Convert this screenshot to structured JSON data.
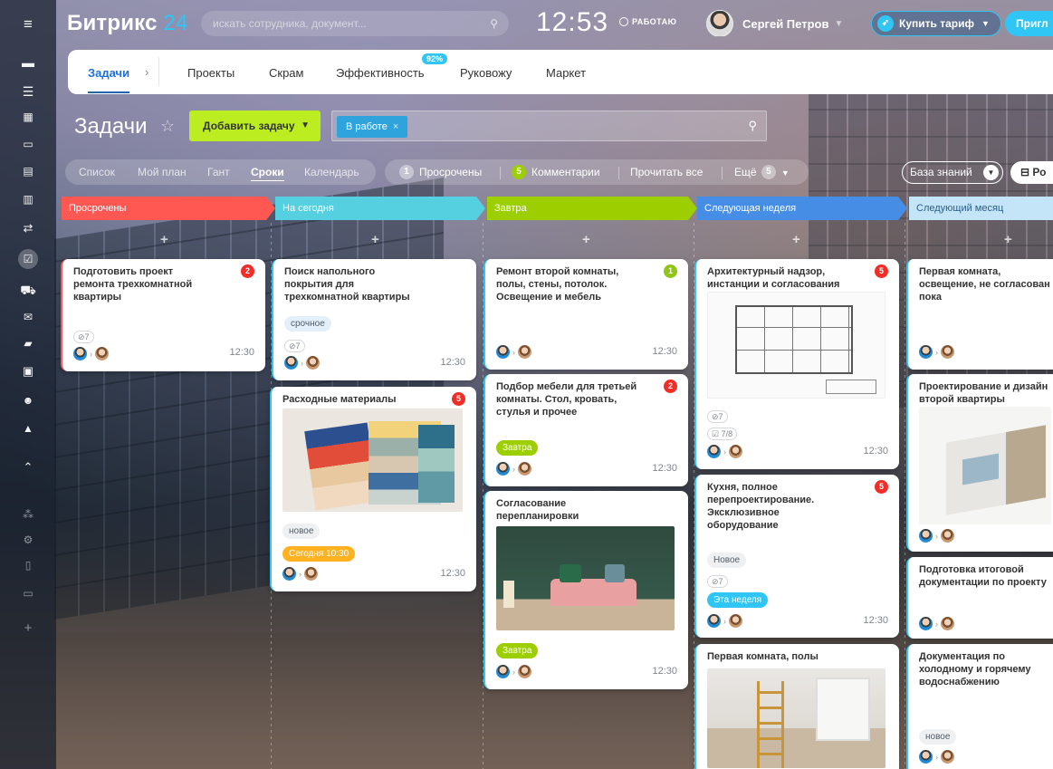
{
  "header": {
    "logo_name": "Битрикс",
    "logo_num": "24",
    "search_placeholder": "искать сотрудника, документ...",
    "clock": "12:53",
    "work_status": "РАБОТАЮ",
    "user_name": "Сергей Петров",
    "buy_label": "Купить тариф",
    "invite_label": "Пригл"
  },
  "tabs": [
    {
      "label": "Задачи"
    },
    {
      "label": "Проекты"
    },
    {
      "label": "Скрам"
    },
    {
      "label": "Эффективность",
      "badge": "92%"
    },
    {
      "label": "Руковожу"
    },
    {
      "label": "Маркет"
    }
  ],
  "page": {
    "title": "Задачи",
    "add_button": "Добавить задачу",
    "filter_chip": "В работе"
  },
  "views": [
    "Список",
    "Мой план",
    "Гант",
    "Сроки",
    "Календарь"
  ],
  "counters": {
    "overdue_count": "1",
    "overdue_label": "Просрочены",
    "comments_count": "5",
    "comments_label": "Комментарии",
    "read_all": "Прочитать все",
    "more_label": "Ещё",
    "more_count": "5"
  },
  "knowledge_base": "База знаний",
  "ro_label": "Ро",
  "columns": [
    {
      "title": "Просрочены",
      "color": "#ff5752"
    },
    {
      "title": "На сегодня",
      "color": "#55d0e0"
    },
    {
      "title": "Завтра",
      "color": "#9dcf00"
    },
    {
      "title": "Следующая неделя",
      "color": "#468ee5"
    },
    {
      "title": "Следующий месяц",
      "color": "#c4e4f7"
    }
  ],
  "cards": {
    "c1": {
      "title": "Подготовить проект\nремонта трехкомнатной\nквартиры",
      "count": "2",
      "attach": "7",
      "time": "12:30"
    },
    "c2": {
      "title": "Поиск напольного\nпокрытия для\nтрехкомнатной квартиры",
      "tag": "срочное",
      "attach": "7",
      "time": "12:30"
    },
    "c3": {
      "title": "Расходные материалы",
      "count": "5",
      "tag": "новое",
      "deadline": "Сегодня 10:30",
      "time": "12:30"
    },
    "c4": {
      "title": "Ремонт второй комнаты,\nполы, стены, потолок.\nОсвещение и  мебель",
      "count": "1",
      "time": "12:30"
    },
    "c5": {
      "title": "Подбор мебели для третьей\nкомнаты. Стол, кровать,\nстулья и прочее",
      "count": "2",
      "deadline": "Завтра",
      "time": "12:30"
    },
    "c6": {
      "title": "Согласование\nперепланировки",
      "deadline": "Завтра",
      "time": "12:30"
    },
    "c7": {
      "title": "Архитектурный надзор,\nинстанции и согласования",
      "count": "5",
      "attach": "7",
      "checklist": "7/8",
      "time": "12:30"
    },
    "c8": {
      "title": "Кухня, полное\nперепроектирование.\nЭксклюзивное\nоборудование",
      "count": "5",
      "tag": "Новое",
      "attach": "7",
      "deadline": "Эта неделя",
      "time": "12:30"
    },
    "c9": {
      "title": "Первая комната, полы"
    },
    "c10": {
      "title": "Первая комната,\nосвещение, не согласован\nпока"
    },
    "c11": {
      "title": "Проектирование и дизайн\nвторой квартиры"
    },
    "c12": {
      "title": "Подготовка итоговой\nдокументации по проекту"
    },
    "c13": {
      "title": "Документация по\nхолодному и горячему\nводоснабжению",
      "tag": "новое"
    }
  }
}
